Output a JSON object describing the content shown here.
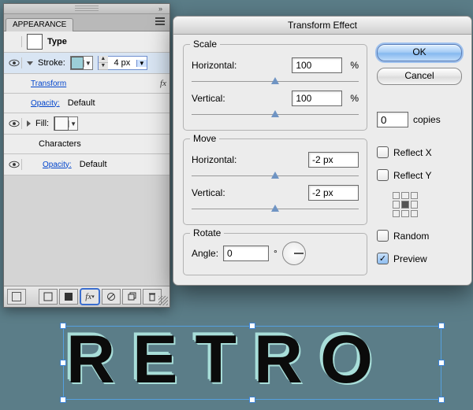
{
  "appearance": {
    "tab": "APPEARANCE",
    "type_label": "Type",
    "stroke_label": "Stroke:",
    "stroke_width": "4 px",
    "transform_label": "Transform",
    "opacity_label": "Opacity:",
    "opacity_value": "Default",
    "fill_label": "Fill:",
    "characters_label": "Characters"
  },
  "dialog": {
    "title": "Transform Effect",
    "scale": {
      "legend": "Scale",
      "h_label": "Horizontal:",
      "h_value": "100",
      "h_unit": "%",
      "v_label": "Vertical:",
      "v_value": "100",
      "v_unit": "%"
    },
    "move": {
      "legend": "Move",
      "h_label": "Horizontal:",
      "h_value": "-2 px",
      "v_label": "Vertical:",
      "v_value": "-2 px"
    },
    "rotate": {
      "legend": "Rotate",
      "label": "Angle:",
      "value": "0",
      "unit": "°"
    },
    "ok": "OK",
    "cancel": "Cancel",
    "copies_value": "0",
    "copies_label": "copies",
    "reflect_x": "Reflect X",
    "reflect_y": "Reflect Y",
    "random": "Random",
    "preview": "Preview"
  },
  "art": {
    "text": "RETRO"
  }
}
